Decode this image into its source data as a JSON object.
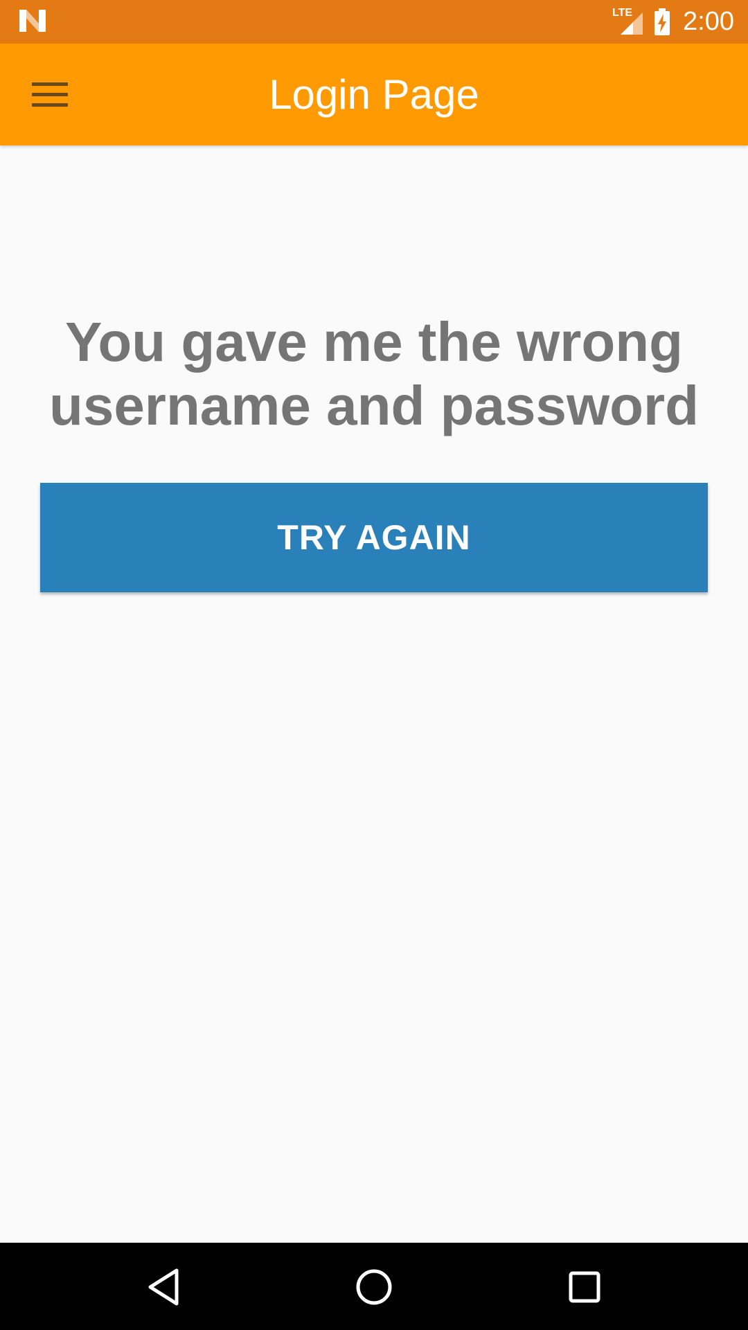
{
  "status_bar": {
    "network_label": "LTE",
    "time": "2:00",
    "icons": [
      "notification-n-icon",
      "lte-signal-icon",
      "battery-charging-icon"
    ]
  },
  "app_bar": {
    "title": "Login Page",
    "menu_icon": "hamburger-menu-icon"
  },
  "content": {
    "message": "You gave me the wrong username and password",
    "button_label": "TRY AGAIN"
  },
  "nav_bar": {
    "icons": [
      "back-icon",
      "home-icon",
      "recents-icon"
    ]
  },
  "colors": {
    "status_bar": "#e47a14",
    "app_bar": "#ff9a02",
    "button": "#2a80b9",
    "message_text": "#757575",
    "background": "#fafafa"
  }
}
